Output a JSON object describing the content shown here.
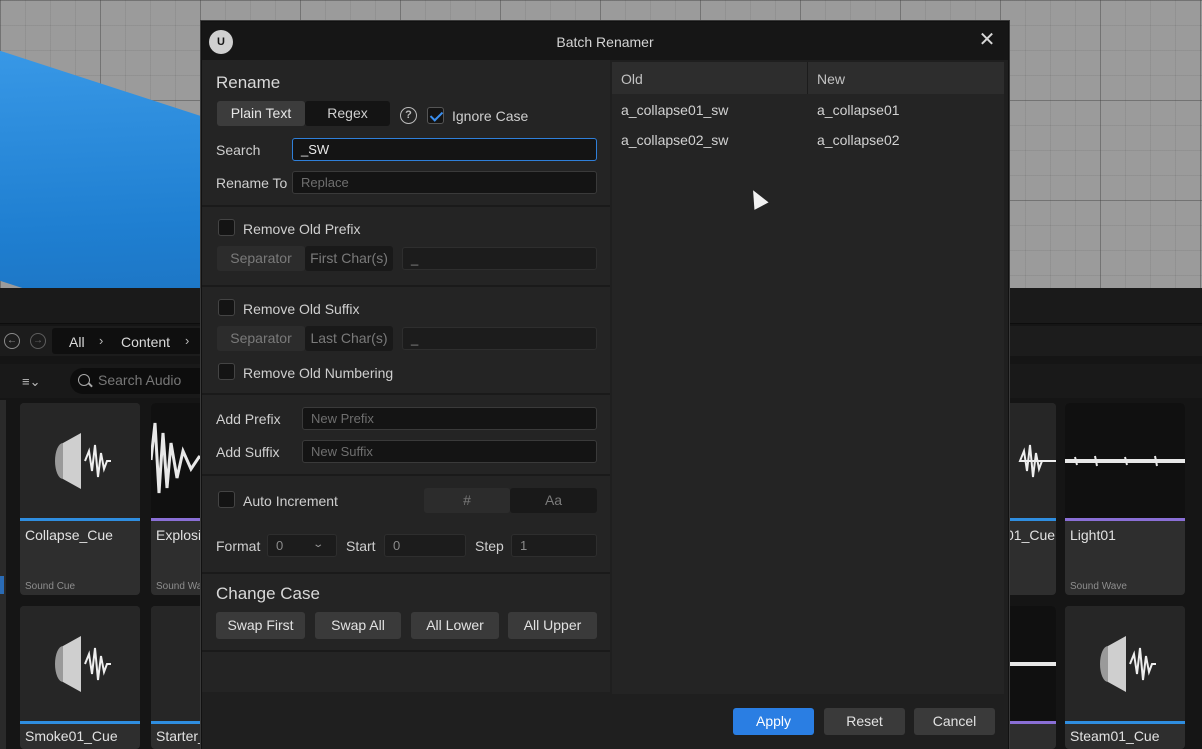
{
  "dialog": {
    "title": "Batch Renamer",
    "logo_text": "U",
    "close_glyph": "✕"
  },
  "rename": {
    "heading": "Rename",
    "mode_plain": "Plain Text",
    "mode_regex": "Regex",
    "help_glyph": "?",
    "ignore_case_label": "Ignore Case",
    "ignore_case_checked": true,
    "search_label": "Search",
    "search_value": "_SW",
    "rename_to_label": "Rename To",
    "rename_to_placeholder": "Replace"
  },
  "prefix": {
    "remove_label": "Remove Old Prefix",
    "separator_label": "Separator",
    "first_chars_label": "First Char(s)",
    "value": "_"
  },
  "suffix": {
    "remove_label": "Remove Old Suffix",
    "separator_label": "Separator",
    "last_chars_label": "Last Char(s)",
    "value": "_",
    "remove_numbering_label": "Remove Old Numbering"
  },
  "add": {
    "prefix_label": "Add Prefix",
    "prefix_placeholder": "New Prefix",
    "suffix_label": "Add Suffix",
    "suffix_placeholder": "New Suffix"
  },
  "increment": {
    "label": "Auto Increment",
    "hash_label": "#",
    "alpha_label": "Aa",
    "format_label": "Format",
    "format_value": "0",
    "start_label": "Start",
    "start_value": "0",
    "step_label": "Step",
    "step_value": "1"
  },
  "change_case": {
    "heading": "Change Case",
    "swap_first": "Swap First",
    "swap_all": "Swap All",
    "all_lower": "All Lower",
    "all_upper": "All Upper"
  },
  "preview": {
    "old_header": "Old",
    "new_header": "New",
    "rows": [
      {
        "old": "a_collapse01_sw",
        "new": "a_collapse01"
      },
      {
        "old": "a_collapse02_sw",
        "new": "a_collapse02"
      }
    ]
  },
  "footer": {
    "apply": "Apply",
    "reset": "Reset",
    "cancel": "Cancel"
  },
  "browser": {
    "back_glyph": "←",
    "forward_glyph": "→",
    "crumbs": [
      "All",
      "Content"
    ],
    "crumb_sep": "›",
    "filter_glyph": "≡⌄",
    "search_placeholder": "Search Audio",
    "tiles": [
      {
        "name": "Collapse_Cue",
        "type": "Sound Cue"
      },
      {
        "name": "Explosi",
        "type": "Sound Wav"
      },
      {
        "name": "01_Cue",
        "type": ""
      },
      {
        "name": "Light01",
        "type": "Sound Wave"
      },
      {
        "name": "Smoke01_Cue",
        "type": ""
      },
      {
        "name": "Starter_",
        "type": ""
      },
      {
        "name": "Steam01_Cue",
        "type": ""
      }
    ]
  },
  "colors": {
    "accent": "#2a7ee3",
    "cue_bar": "#2f8ee0",
    "wave_bar": "#8a6fd6",
    "cube": "#1f7fd1"
  }
}
